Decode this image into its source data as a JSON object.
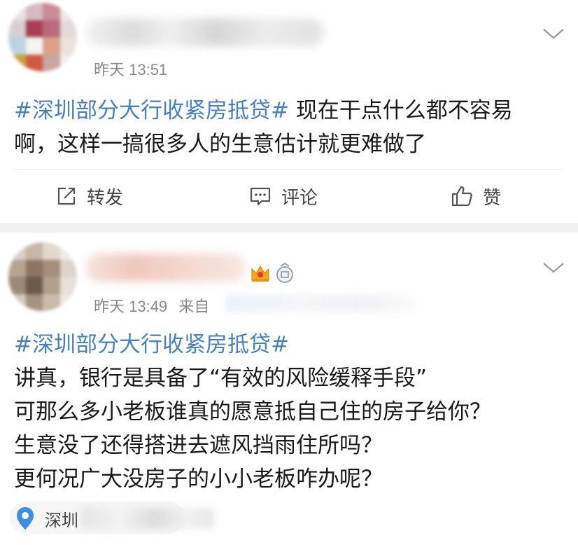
{
  "posts": [
    {
      "time": "昨天 13:51",
      "hashtag": "#深圳部分大行收紧房抵贷#",
      "text_line1_rest": " 现在干点什么都不容易",
      "text_line2": "啊，这样一搞很多人的生意估计就更难做了",
      "actions": {
        "repost": "转发",
        "comment": "评论",
        "like": "赞"
      }
    },
    {
      "time": "昨天 13:49",
      "source_prefix": "来自",
      "hashtag": "#深圳部分大行收紧房抵贷#",
      "lines": [
        "讲真，银行是具备了“有效的风险缓释手段”",
        "可那么多小老板谁真的愿意抵自己住的房子给你？",
        "生意没了还得搭进去遮风挡雨住所吗？",
        "更何况广大没房子的小小老板咋办呢？"
      ],
      "location": "深圳"
    }
  ],
  "icons": [
    "repost-icon",
    "comment-icon",
    "thumbs-up-icon",
    "chevron-down-icon",
    "crown-badge-icon",
    "member-badge-icon",
    "location-pin-icon"
  ],
  "colors": {
    "hashtag": "#4a7fb8",
    "meta": "#8a8a8a",
    "pin": "#3b8fe6",
    "crown": "#f3a81c"
  }
}
